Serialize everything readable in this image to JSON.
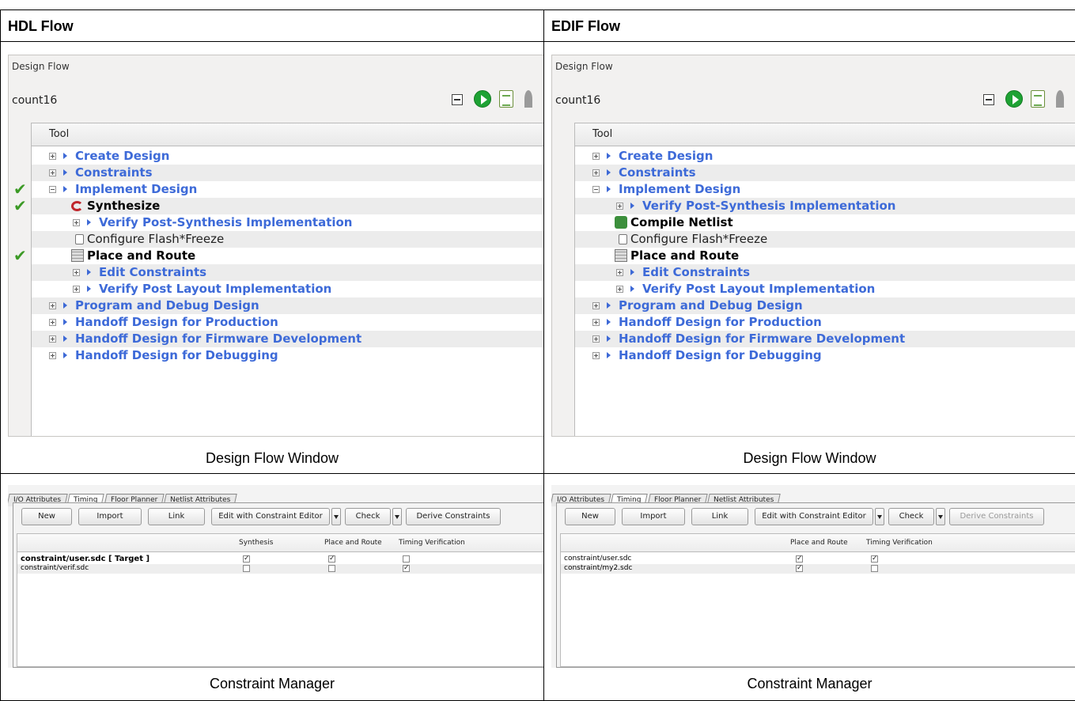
{
  "header": {
    "left": "HDL Flow",
    "right": "EDIF Flow"
  },
  "captions": {
    "design_flow": "Design Flow Window",
    "constraint_manager": "Constraint Manager"
  },
  "hdl_flow": {
    "design_flow": {
      "panel_title": "Design Flow",
      "project": "count16",
      "column_header": "Tool",
      "rows": [
        {
          "label": "Create Design"
        },
        {
          "label": "Constraints"
        },
        {
          "label": "Implement Design"
        },
        {
          "label": "Synthesize"
        },
        {
          "label": "Verify Post-Synthesis Implementation"
        },
        {
          "label": "Configure Flash*Freeze"
        },
        {
          "label": "Place and Route"
        },
        {
          "label": "Edit Constraints"
        },
        {
          "label": "Verify Post Layout Implementation"
        },
        {
          "label": "Program and Debug Design"
        },
        {
          "label": "Handoff Design for Production"
        },
        {
          "label": "Handoff Design for Firmware Development"
        },
        {
          "label": "Handoff Design for Debugging"
        }
      ]
    },
    "constraint_manager": {
      "tabs": [
        "I/O Attributes",
        "Timing",
        "Floor Planner",
        "Netlist Attributes"
      ],
      "buttons": {
        "new": "New",
        "import": "Import",
        "link": "Link",
        "edit": "Edit with Constraint Editor",
        "check": "Check",
        "derive": "Derive Constraints"
      },
      "columns": [
        "Synthesis",
        "Place and Route",
        "Timing Verification"
      ],
      "rows": [
        {
          "file": "constraint/user.sdc  [ Target ]",
          "checks": [
            true,
            true,
            false
          ]
        },
        {
          "file": "constraint/verif.sdc",
          "checks": [
            false,
            false,
            true
          ]
        }
      ]
    }
  },
  "edif_flow": {
    "design_flow": {
      "panel_title": "Design Flow",
      "project": "count16",
      "column_header": "Tool",
      "rows": [
        {
          "label": "Create Design"
        },
        {
          "label": "Constraints"
        },
        {
          "label": "Implement Design"
        },
        {
          "label": "Verify Post-Synthesis Implementation"
        },
        {
          "label": "Compile Netlist"
        },
        {
          "label": "Configure Flash*Freeze"
        },
        {
          "label": "Place and Route"
        },
        {
          "label": "Edit Constraints"
        },
        {
          "label": "Verify Post Layout Implementation"
        },
        {
          "label": "Program and Debug Design"
        },
        {
          "label": "Handoff Design for Production"
        },
        {
          "label": "Handoff Design for Firmware Development"
        },
        {
          "label": "Handoff Design for Debugging"
        }
      ]
    },
    "constraint_manager": {
      "tabs": [
        "I/O Attributes",
        "Timing",
        "Floor Planner",
        "Netlist Attributes"
      ],
      "buttons": {
        "new": "New",
        "import": "Import",
        "link": "Link",
        "edit": "Edit with Constraint Editor",
        "check": "Check",
        "derive": "Derive Constraints"
      },
      "columns": [
        "Place and Route",
        "Timing Verification"
      ],
      "rows": [
        {
          "file": "constraint/user.sdc",
          "checks": [
            true,
            true
          ]
        },
        {
          "file": "constraint/my2.sdc",
          "checks": [
            true,
            false
          ]
        }
      ]
    }
  }
}
